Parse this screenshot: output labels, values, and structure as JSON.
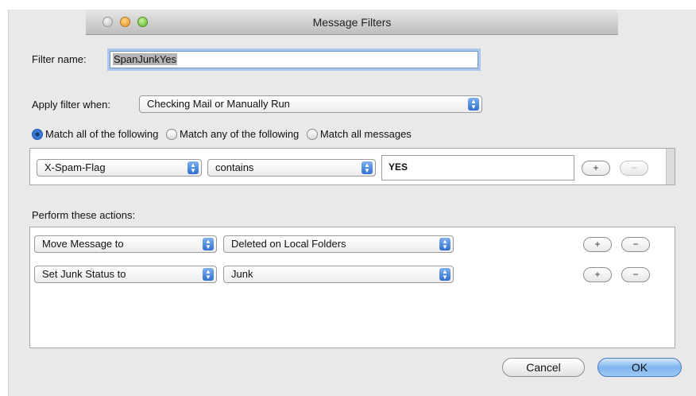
{
  "window": {
    "title": "Message Filters"
  },
  "filter_name": {
    "label": "Filter name:",
    "value": "SpanJunkYes"
  },
  "apply_when": {
    "label": "Apply filter when:",
    "selected": "Checking Mail or Manually Run"
  },
  "match_options": [
    {
      "label": "Match all of the following",
      "selected": true
    },
    {
      "label": "Match any of the following",
      "selected": false
    },
    {
      "label": "Match all messages",
      "selected": false
    }
  ],
  "condition": {
    "field": "X-Spam-Flag",
    "operator": "contains",
    "value": "YES",
    "add_label": "+",
    "remove_label": "−"
  },
  "actions": {
    "heading": "Perform these actions:",
    "rows": [
      {
        "action": "Move Message to",
        "target": "Deleted on Local Folders",
        "add_label": "+",
        "remove_label": "−"
      },
      {
        "action": "Set Junk Status to",
        "target": "Junk",
        "add_label": "+",
        "remove_label": "−"
      }
    ]
  },
  "buttons": {
    "cancel": "Cancel",
    "ok": "OK"
  },
  "icons": {
    "stepper": "up-down-arrows-icon"
  }
}
